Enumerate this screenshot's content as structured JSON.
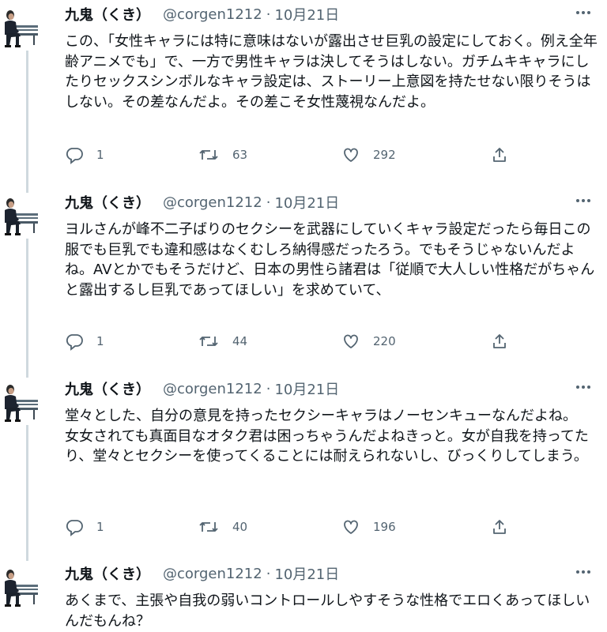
{
  "author": {
    "name": "九鬼（くき）",
    "handle": "@corgen1212",
    "separator": "·"
  },
  "icons": {
    "reply": "reply-icon",
    "retweet": "retweet-icon",
    "like": "heart-icon",
    "share": "share-icon",
    "more": "more-icon"
  },
  "colors": {
    "text": "#0f1419",
    "muted": "#536471",
    "thread_line": "#cfd9de"
  },
  "tweets": [
    {
      "date": "10月21日",
      "text": "この、「女性キャラには特に意味はないが露出させ巨乳の設定にしておく。例え全年齢アニメでも」で、一方で男性キャラは決してそうはしない。ガチムキキャラにしたりセックスシンボルなキャラ設定は、ストーリー上意図を持たせない限りそうはしない。その差なんだよ。その差こそ女性蔑視なんだよ。",
      "replies": "1",
      "retweets": "63",
      "likes": "292"
    },
    {
      "date": "10月21日",
      "text": "ヨルさんが峰不二子ばりのセクシーを武器にしていくキャラ設定だったら毎日この服でも巨乳でも違和感はなくむしろ納得感だったろう。でもそうじゃないんだよね。AVとかでもそうだけど、日本の男性ら諸君は「従順で大人しい性格だがちゃんと露出するし巨乳であってほしい」を求めていて、",
      "replies": "1",
      "retweets": "44",
      "likes": "220"
    },
    {
      "date": "10月21日",
      "text": "堂々とした、自分の意見を持ったセクシーキャラはノーセンキューなんだよね。\n女女されても真面目なオタク君は困っちゃうんだよねきっと。女が自我を持ってたり、堂々とセクシーを使ってくることには耐えられないし、びっくりしてしまう。",
      "replies": "1",
      "retweets": "40",
      "likes": "196"
    },
    {
      "date": "10月21日",
      "text": "あくまで、主張や自我の弱いコントロールしやすそうな性格でエロくあってほしいんだもんね？"
    }
  ]
}
